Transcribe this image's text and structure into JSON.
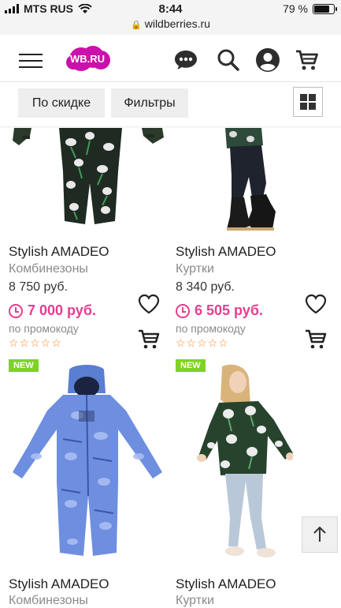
{
  "status": {
    "carrier": "MTS RUS",
    "time": "8:44",
    "battery_text": "79 %",
    "battery_level": 0.79
  },
  "browser": {
    "url": "wildberries.ru"
  },
  "header": {
    "logo_text": "WB.RU",
    "icons": [
      "menu-icon",
      "chat-icon",
      "search-icon",
      "account-icon",
      "cart-icon"
    ]
  },
  "filters": {
    "discount_label": "По скидке",
    "filters_label": "Фильтры"
  },
  "products": [
    {
      "brand": "Stylish AMADEO",
      "category": "Комбинезоны",
      "old_price": "8 750 руб.",
      "promo_price": "7 000 руб.",
      "promo_note": "по промокоду",
      "rating": "☆☆☆☆☆"
    },
    {
      "brand": "Stylish AMADEO",
      "category": "Куртки",
      "old_price": "8 340 руб.",
      "promo_price": "6 505 руб.",
      "promo_note": "по промокоду",
      "rating": "☆☆☆☆☆"
    },
    {
      "badge": "NEW",
      "brand": "Stylish AMADEO",
      "category": "Комбинезоны"
    },
    {
      "badge": "NEW",
      "brand": "Stylish AMADEO",
      "category": "Куртки"
    }
  ],
  "colors": {
    "brand": "#cb11ab",
    "promo": "#e83d8f",
    "new_badge": "#7ed321",
    "rating": "#f58a2b"
  }
}
